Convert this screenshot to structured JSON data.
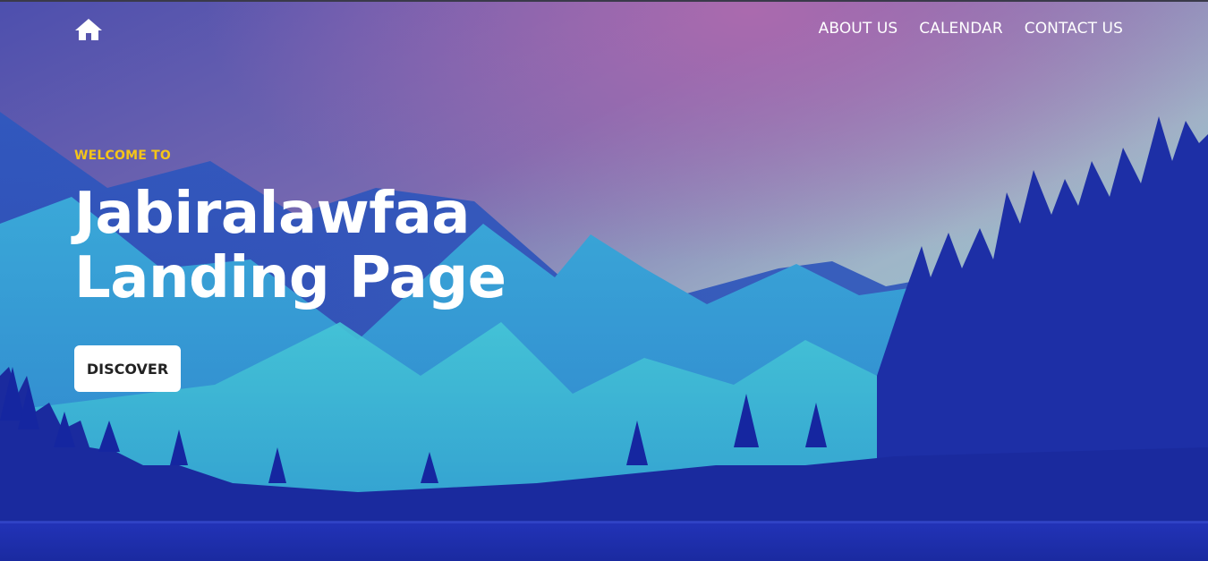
{
  "nav": {
    "home_icon": "home-icon",
    "items": [
      {
        "label": "ABOUT US"
      },
      {
        "label": "CALENDAR"
      },
      {
        "label": "CONTACT US"
      }
    ]
  },
  "hero": {
    "eyebrow": "WELCOME TO",
    "title_line1": "Jabiralawfaa",
    "title_line2": "Landing Page",
    "cta_label": "DISCOVER"
  },
  "colors": {
    "eyebrow": "#f5c518",
    "text": "#ffffff",
    "button_bg": "#ffffff",
    "button_text": "#222222"
  }
}
